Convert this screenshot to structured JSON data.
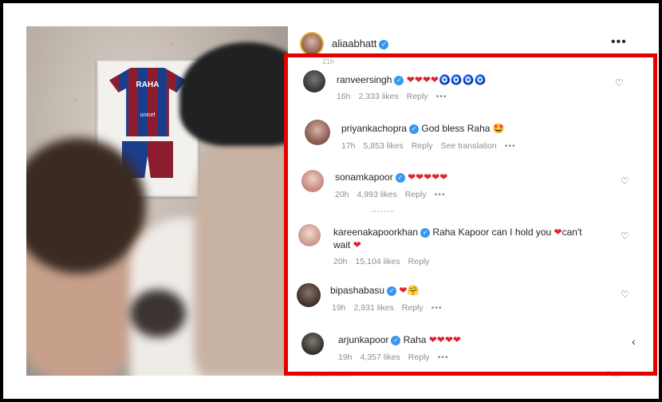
{
  "post": {
    "username": "aliaabhatt",
    "more_label": "•••",
    "jersey_text": "RAHA",
    "jersey_sponsor": "unicef"
  },
  "clipped_top": "21h",
  "clipped_bottom_left": "Add a comment...",
  "clipped_bottom_right": "Post",
  "comments": [
    {
      "username": "ranveersingh",
      "text": "",
      "emojis": "❤❤❤❤",
      "extra_emojis": "🧿🧿🧿🧿",
      "time": "16h",
      "likes": "2,333 likes",
      "reply": "Reply",
      "translation": "",
      "more": "•••"
    },
    {
      "username": "priyankachopra",
      "text": "God bless Raha",
      "emojis": "🤩",
      "extra_emojis": "",
      "time": "17h",
      "likes": "5,853 likes",
      "reply": "Reply",
      "translation": "See translation",
      "more": "•••"
    },
    {
      "username": "sonamkapoor",
      "text": "",
      "emojis": "❤❤❤❤❤",
      "extra_emojis": "",
      "time": "20h",
      "likes": "4,993 likes",
      "reply": "Reply",
      "translation": "",
      "more": "•••"
    },
    {
      "username": "kareenakapoorkhan",
      "text": "Raha Kapoor can I hold you",
      "emojis": "❤",
      "text2": "can't",
      "line2": "wait",
      "line2_emoji": "❤",
      "time": "20h",
      "likes": "15,104 likes",
      "reply": "Reply",
      "translation": "",
      "more": ""
    },
    {
      "username": "bipashabasu",
      "text": "",
      "emojis": "❤",
      "extra_emojis": "🤗",
      "time": "19h",
      "likes": "2,931 likes",
      "reply": "Reply",
      "translation": "",
      "more": "•••"
    },
    {
      "username": "arjunkapoor",
      "text": "Raha",
      "emojis": "❤❤❤❤",
      "extra_emojis": "",
      "time": "19h",
      "likes": "4,357 likes",
      "reply": "Reply",
      "translation": "",
      "more": "•••"
    }
  ],
  "colors": {
    "highlight": "#e50000",
    "verified": "#3897f0",
    "heart": "#e0202a"
  }
}
